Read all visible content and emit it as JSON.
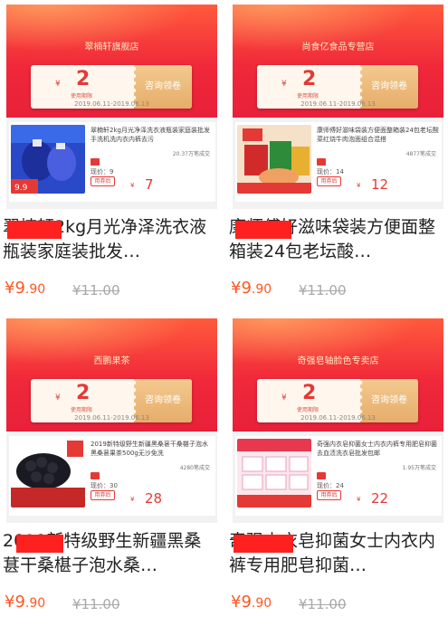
{
  "cards": [
    {
      "shop_name": "翠楠轩旗舰店",
      "coupon_yen": "¥",
      "coupon_amount": "2",
      "coupon_sub": "使用期限",
      "coupon_button": "咨询领卷",
      "coupon_date": "2019.06.11-2019.06.13",
      "product_title": "翠楠轩2kg月光净泽洗衣液瓶装家庭装批发手洗机洗内衣内裤去污",
      "sales": "20.37万笔成交",
      "now_price_label": "现价：9",
      "buy_label": "用券后",
      "final_yen": "¥",
      "final_price": "7",
      "title": "翠楠轩2kg月光净泽洗衣液瓶装家庭装批发…",
      "price_yen": "¥",
      "price_int": "9",
      "price_dec": ".90",
      "orig_price": "¥11.00"
    },
    {
      "shop_name": "尚食亿食品专营店",
      "coupon_yen": "¥",
      "coupon_amount": "2",
      "coupon_sub": "使用期限",
      "coupon_button": "咨询领卷",
      "coupon_date": "2019.06.11-2019.06.13",
      "product_title": "康师傅好滋味袋装方便面整箱装24包老坛酸菜红烧牛肉泡面组合混搭",
      "sales": "4877笔成交",
      "now_price_label": "现价：14",
      "buy_label": "用券后",
      "final_yen": "¥",
      "final_price": "12",
      "title": "康师傅好滋味袋装方便面整箱装24包老坛酸…",
      "price_yen": "¥",
      "price_int": "9",
      "price_dec": ".90",
      "orig_price": "¥11.00"
    },
    {
      "shop_name": "西鹏果茶",
      "coupon_yen": "¥",
      "coupon_amount": "2",
      "coupon_sub": "使用期限",
      "coupon_button": "咨询领卷",
      "coupon_date": "2019.06.11-2019.06.13",
      "product_title": "2019新特级野生新疆黑桑葚干桑椹子泡水黑桑葚果茶500g无沙免洗",
      "sales": "4280笔成交",
      "now_price_label": "现价：30",
      "buy_label": "用券后",
      "final_yen": "¥",
      "final_price": "28",
      "title": "2019新特级野生新疆黑桑葚干桑椹子泡水桑…",
      "price_yen": "¥",
      "price_int": "9",
      "price_dec": ".90",
      "orig_price": "¥11.00"
    },
    {
      "shop_name": "奇强皂轴脸色专卖店",
      "coupon_yen": "¥",
      "coupon_amount": "2",
      "coupon_sub": "使用期限",
      "coupon_button": "咨询领卷",
      "coupon_date": "2019.06.11-2019.06.13",
      "product_title": "奇强内衣皂抑菌女士内衣内裤专用肥皂抑菌去血渍洗衣皂批发包邮",
      "sales": "1.95万笔成交",
      "now_price_label": "现价：24",
      "buy_label": "用券后",
      "final_yen": "¥",
      "final_price": "22",
      "title": "奇强内衣皂抑菌女士内衣内裤专用肥皂抑菌…",
      "price_yen": "¥",
      "price_int": "9",
      "price_dec": ".90",
      "orig_price": "¥11.00"
    }
  ],
  "colors": {
    "accent": "#e53935",
    "price": "#ff5722",
    "banner": "#f0283a",
    "coupon_button": "#e6ad6a"
  }
}
